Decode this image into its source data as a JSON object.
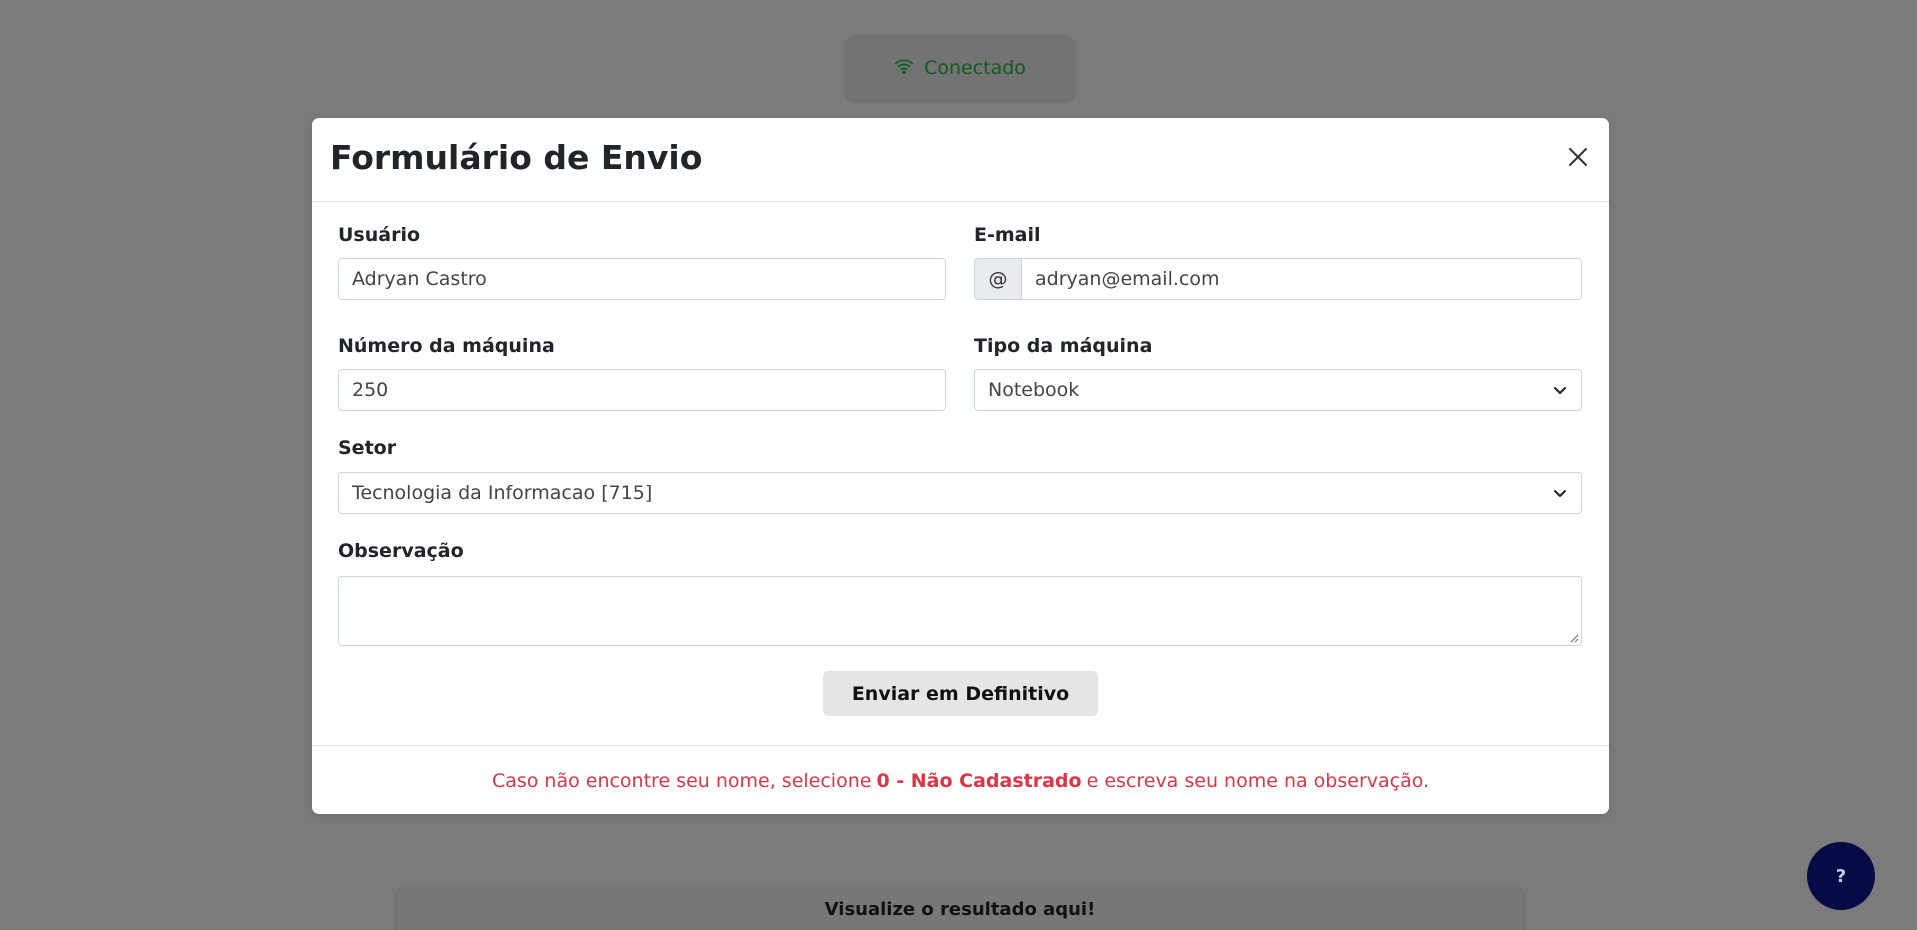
{
  "background": {
    "status": {
      "label": "Conectado",
      "icon": "wifi-icon",
      "color": "#0f5d1d"
    },
    "result_title": "Visualize o resultado aqui!",
    "help_button_label": "?"
  },
  "modal": {
    "title": "Formulário de Envio",
    "close_icon": "close-icon",
    "fields": {
      "usuario": {
        "label": "Usuário",
        "value": "Adryan Castro"
      },
      "email": {
        "label": "E-mail",
        "addon": "@",
        "value": "adryan@email.com"
      },
      "numero_maquina": {
        "label": "Número da máquina",
        "value": "250"
      },
      "tipo_maquina": {
        "label": "Tipo da máquina",
        "value": "Notebook"
      },
      "setor": {
        "label": "Setor",
        "value": "Tecnologia da Informacao [715]"
      },
      "observacao": {
        "label": "Observação",
        "value": ""
      }
    },
    "submit_label": "Enviar em Definitivo",
    "footer": {
      "prefix": "Caso não encontre seu nome, selecione",
      "highlight": "0 - Não Cadastrado",
      "suffix": "e escreva seu nome na observação.",
      "color": "#dc3545"
    }
  }
}
